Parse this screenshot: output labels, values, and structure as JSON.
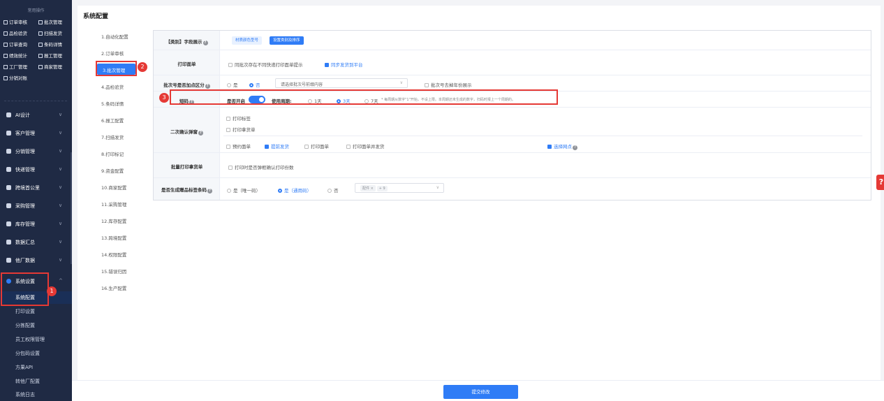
{
  "sidebar": {
    "quick_title": "常用操作",
    "quick_items": [
      "订单审核",
      "批次管理",
      "品检验货",
      "扫描发货",
      "订单查询",
      "条码详情",
      "绩效统计",
      "报工管理",
      "工厂管理",
      "商家管理",
      "分销对账"
    ],
    "menus": [
      "AI设计",
      "客户管理",
      "分销管理",
      "快递管理",
      "跨境首公里",
      "采购管理",
      "库存管理",
      "数据汇总",
      "他厂数据"
    ],
    "system": {
      "label": "系统设置",
      "chevron": "^",
      "sub": [
        "系统配置",
        "打印设置",
        "分拣配置",
        "员工权限管理",
        "分包码设置",
        "方果API",
        "转他厂配置",
        "系统日志"
      ]
    },
    "chevron": "∨"
  },
  "page_title": "系统配置",
  "toc": [
    "1.自动化配置",
    "2.订单审核",
    "3.批次管理",
    "4.品检验货",
    "5.条码详情",
    "6.报工配置",
    "7.扫描发货",
    "8.打印标记",
    "9.资金配置",
    "10.商家配置",
    "11.采购管理",
    "12.库存配置",
    "13.跨境配置",
    "14.权限配置",
    "15.错误归因",
    "16.生产配置"
  ],
  "badges": [
    "1",
    "2",
    "3"
  ],
  "rows": {
    "r1": {
      "label": "【类别】字段展示",
      "tag1": "材质颜色型号",
      "tag2": "设置类别及排序"
    },
    "r2": {
      "label": "打印面单",
      "opt1": "同批次存在不同快递打印面单提示",
      "opt2": "同步发货到平台"
    },
    "r3": {
      "label": "批次号是否加点区分",
      "yes": "是",
      "no": "否",
      "select_placeholder": "请选择批次号前缀内容",
      "arrow": "∨",
      "opt": "批次号去掉年份展示"
    },
    "r4": {
      "label": "短码",
      "enable_label": "是否开启",
      "cycle_label": "使用周期:",
      "d1": "1天",
      "d3": "3天",
      "d7": "7天",
      "note": "* 每周期从数字\"1\"开始，不设上限。本周期还未生成的数字，扫码时报上一个周期的。"
    },
    "r5": {
      "label": "二次确认弹窗",
      "c1": "打印标签",
      "c2": "打印拿货单",
      "c3": "预约面单",
      "c4": "提前发货",
      "c5": "打印面单",
      "c6": "打印面单并发货",
      "c7": "选择网点"
    },
    "r6": {
      "label": "批量打印拿货单",
      "opt": "打印时是否弹框确认打印份数"
    },
    "r7": {
      "label": "是否生成赠品标签条码",
      "o1": "是（唯一码）",
      "o2": "是（通用码）",
      "o3": "否",
      "chip1": "配件 ×",
      "chip2": "+ 9",
      "arrow": "∨"
    }
  },
  "help": "?",
  "submit": "提交修改"
}
